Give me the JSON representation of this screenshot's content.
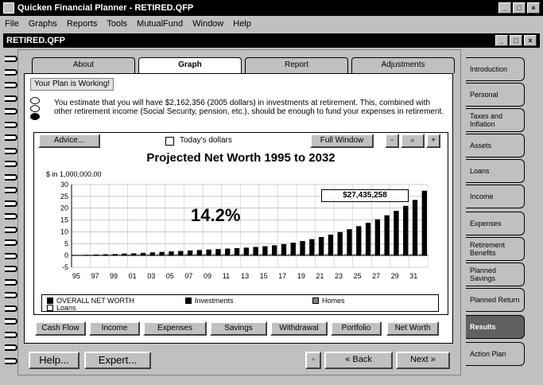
{
  "window": {
    "title": "Quicken Financial Planner - RETIRED.QFP"
  },
  "menu": [
    "File",
    "Graphs",
    "Reports",
    "Tools",
    "MutualFund",
    "Window",
    "Help"
  ],
  "document": {
    "title": "RETIRED.QFP"
  },
  "tabs": [
    "About",
    "Graph",
    "Report",
    "Adjustments"
  ],
  "status": {
    "badge": "Your Plan is Working!"
  },
  "message": "You estimate that you will have $2,162,356 (2005 dollars) in investments at retirement. This, combined with other retirement income (Social Security, pension, etc.), should be enough to fund your expenses in retirement.",
  "toolbar": {
    "advice": "Advice...",
    "todays_dollars": "Today's dollars",
    "full_window": "Full Window"
  },
  "chart": {
    "title": "Projected Net Worth  1995 to 2032",
    "ylabel": "$ in 1,000,000.00",
    "highlight_pct": "14.2%",
    "value_box": "$27,435,258"
  },
  "chart_data": {
    "type": "bar",
    "title": "Projected Net Worth  1995 to 2032",
    "ylabel": "$ in 1,000,000.00",
    "ylim": [
      -5,
      30
    ],
    "yticks": [
      -5,
      0,
      5,
      10,
      15,
      20,
      25,
      30
    ],
    "xtick_labels": [
      "95",
      "97",
      "99",
      "01",
      "03",
      "05",
      "07",
      "09",
      "11",
      "13",
      "15",
      "17",
      "19",
      "21",
      "23",
      "25",
      "27",
      "29",
      "31"
    ],
    "categories": [
      "1995",
      "1996",
      "1997",
      "1998",
      "1999",
      "2000",
      "2001",
      "2002",
      "2003",
      "2004",
      "2005",
      "2006",
      "2007",
      "2008",
      "2009",
      "2010",
      "2011",
      "2012",
      "2013",
      "2014",
      "2015",
      "2016",
      "2017",
      "2018",
      "2019",
      "2020",
      "2021",
      "2022",
      "2023",
      "2024",
      "2025",
      "2026",
      "2027",
      "2028",
      "2029",
      "2030",
      "2031",
      "2032"
    ],
    "series": [
      {
        "name": "Investments",
        "values": [
          0.2,
          0.3,
          0.4,
          0.5,
          0.6,
          0.8,
          0.9,
          1.1,
          1.3,
          1.5,
          1.7,
          1.9,
          2.1,
          2.3,
          2.5,
          2.7,
          2.9,
          3.1,
          3.3,
          3.6,
          3.9,
          4.3,
          4.8,
          5.4,
          6.1,
          6.9,
          7.8,
          8.8,
          9.9,
          11.1,
          12.4,
          13.8,
          15.3,
          17.0,
          18.9,
          21.0,
          23.5,
          27.4
        ]
      },
      {
        "name": "Homes",
        "values": [
          0.3,
          0.3,
          0.3,
          0.3,
          0.4,
          0.4,
          0.4,
          0.4,
          0.4,
          0.5,
          0.5,
          0.5,
          0.5,
          0.5,
          0.5,
          0.5,
          0.5,
          0.5,
          0.5,
          0.5,
          0.5,
          0.5,
          0.5,
          0.5,
          0.5,
          0.5,
          0.5,
          0.5,
          0.5,
          0.5,
          0.5,
          0.5,
          0.5,
          0.5,
          0.5,
          0.5,
          0.5,
          0.5
        ]
      }
    ]
  },
  "legend": [
    "OVERALL NET WORTH",
    "Investments",
    "Homes",
    "Loans"
  ],
  "bottom_buttons": [
    "Cash Flow",
    "Income",
    "Expenses",
    "Savings",
    "Withdrawal",
    "Portfolio",
    "Net Worth"
  ],
  "footer": {
    "help": "Help...",
    "expert": "Expert...",
    "back": "Back",
    "next": "Next"
  },
  "sidenav": [
    "Introduction",
    "Personal",
    "Taxes and Inflation",
    "Assets",
    "Loans",
    "Income",
    "Expenses",
    "Retirement Benefits",
    "Planned Savings",
    "Planned Return",
    "Results",
    "Action Plan"
  ]
}
